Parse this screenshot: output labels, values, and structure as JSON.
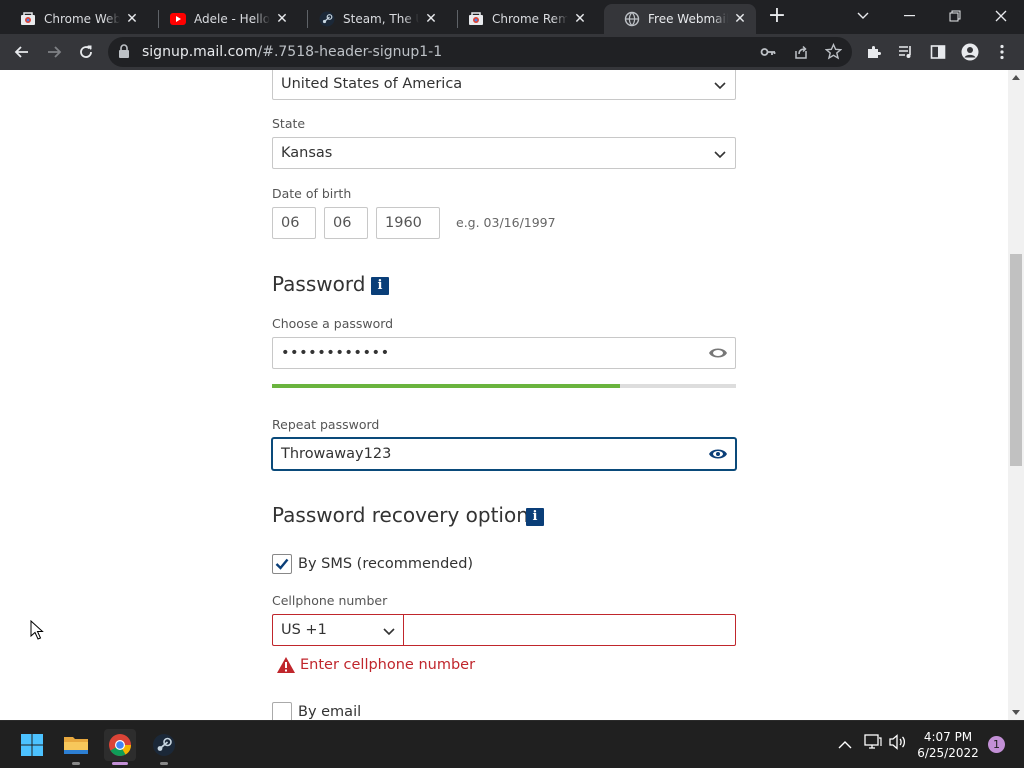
{
  "tabs": [
    {
      "title": "Chrome Web Store",
      "icon": "chrome-web-store-icon"
    },
    {
      "title": "Adele - Hello - YouTube",
      "icon": "youtube-icon"
    },
    {
      "title": "Steam, The Ultimate",
      "icon": "steam-icon"
    },
    {
      "title": "Chrome Remote",
      "icon": "chrome-remote-icon"
    },
    {
      "title": "Free Webmail and",
      "icon": "globe-icon"
    }
  ],
  "omnibox": {
    "host": "signup.mail.com",
    "path": "/#.7518-header-signup1-1"
  },
  "form": {
    "country_value": "United States of America",
    "state_label": "State",
    "state_value": "Kansas",
    "dob_label": "Date of birth",
    "dob_month": "06",
    "dob_day": "06",
    "dob_year": "1960",
    "dob_hint": "e.g. 03/16/1997",
    "password_section": "Password",
    "info_glyph": "i",
    "choose_label": "Choose a password",
    "password_masked": "••••••••••••",
    "strength_fraction": 0.75,
    "repeat_label": "Repeat password",
    "repeat_value": "Throwaway123",
    "recovery_section": "Password recovery options",
    "sms_label": "By SMS (recommended)",
    "sms_checked": true,
    "cell_label": "Cellphone number",
    "country_code": "US +1",
    "cell_value": "",
    "error_text": "Enter cellphone number",
    "email_label": "By email",
    "email_checked": false
  },
  "taskbar": {
    "time": "4:07 PM",
    "date": "6/25/2022",
    "notification_count": "1"
  },
  "colors": {
    "brand_navy": "#0a3e78",
    "error_red": "#c0262c",
    "strength_green": "#6ab43e",
    "accent_purple": "#c390d6"
  }
}
